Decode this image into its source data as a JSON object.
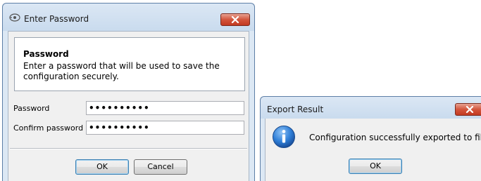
{
  "password_dialog": {
    "title": "Enter Password",
    "heading": "Password",
    "description": "Enter a password that will be used to save the configuration securely.",
    "password_label": "Password",
    "password_value": "••••••••••",
    "confirm_label": "Confirm password",
    "confirm_value": "••••••••••",
    "ok_label": "OK",
    "cancel_label": "Cancel"
  },
  "export_dialog": {
    "title": "Export Result",
    "message": "Configuration successfully exported to file",
    "ok_label": "OK"
  },
  "icons": {
    "app": "key-icon",
    "close": "close-icon",
    "info": "info-icon"
  },
  "colors": {
    "close_button": "#c9452c",
    "title_bar": "#dce8f4",
    "dialog_body": "#f0f0f0",
    "info_icon": "#2a6fc4"
  }
}
